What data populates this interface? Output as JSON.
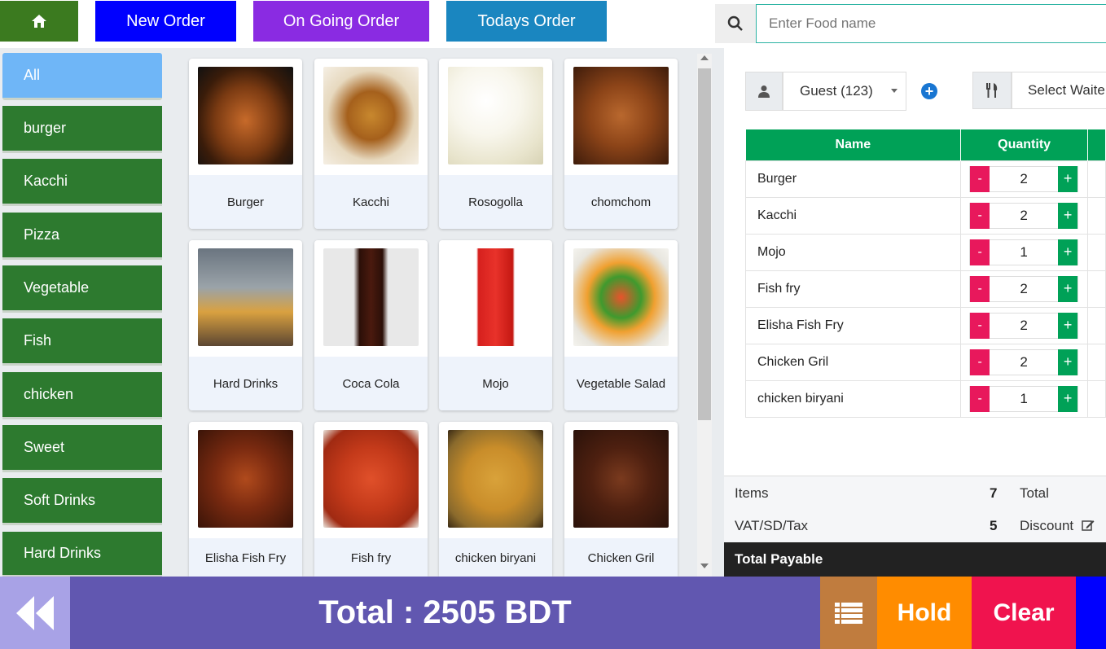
{
  "nav": {
    "new_order": "New Order",
    "ongoing_order": "On Going Order",
    "todays_order": "Todays Order"
  },
  "search": {
    "placeholder": "Enter Food name"
  },
  "categories": [
    "All",
    "burger",
    "Kacchi",
    "Pizza",
    "Vegetable",
    "Fish",
    "chicken",
    "Sweet",
    "Soft Drinks",
    "Hard Drinks"
  ],
  "foods": [
    "Burger",
    "Kacchi",
    "Rosogolla",
    "chomchom",
    "Hard Drinks",
    "Coca Cola",
    "Mojo",
    "Vegetable Salad",
    "Elisha Fish Fry",
    "Fish fry",
    "chicken biryani",
    "Chicken Gril"
  ],
  "customer": {
    "selected": "Guest (123)",
    "waiter_placeholder": "Select Waite"
  },
  "cart": {
    "headers": [
      "Name",
      "Quantity"
    ],
    "rows": [
      {
        "name": "Burger",
        "qty": "2"
      },
      {
        "name": "Kacchi",
        "qty": "2"
      },
      {
        "name": "Mojo",
        "qty": "1"
      },
      {
        "name": "Fish fry",
        "qty": "2"
      },
      {
        "name": "Elisha Fish Fry",
        "qty": "2"
      },
      {
        "name": "Chicken Gril",
        "qty": "2"
      },
      {
        "name": "chicken biryani",
        "qty": "1"
      }
    ],
    "minus": "-",
    "plus": "+"
  },
  "summary": {
    "items_label": "Items",
    "items_value": "7",
    "total_label": "Total",
    "tax_label": "VAT/SD/Tax",
    "tax_value": "5",
    "discount_label": "Discount",
    "payable_label": "Total Payable"
  },
  "footer": {
    "total_text": "Total : 2505 BDT",
    "hold": "Hold",
    "clear": "Clear"
  },
  "colors": {
    "new_order": "#0000ff",
    "ongoing": "#8a2be2",
    "todays": "#1a86c0",
    "home": "#3b7a1f",
    "category": "#2d7a2f",
    "footer": "#6157b0"
  }
}
